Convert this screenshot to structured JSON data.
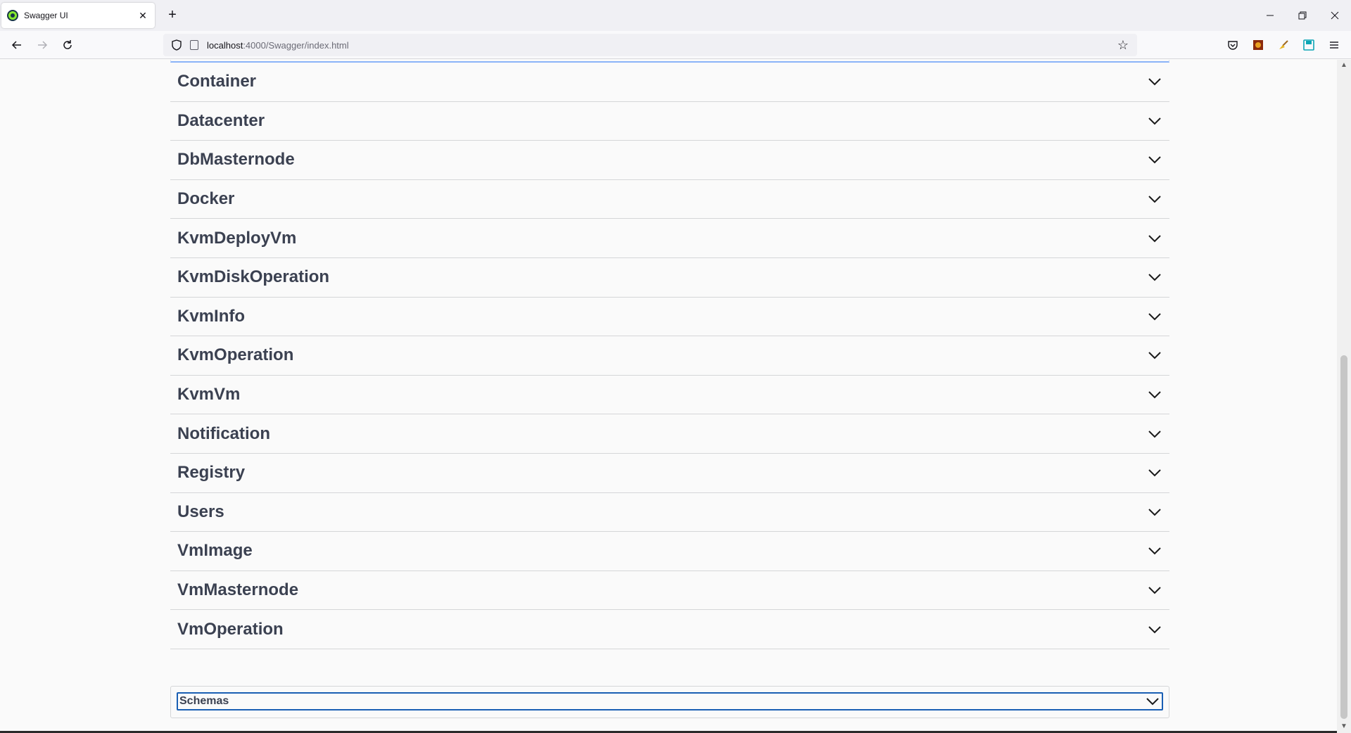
{
  "browser": {
    "tab_title": "Swagger UI",
    "new_tab_label": "+",
    "url_host": "localhost",
    "url_path": ":4000/Swagger/index.html"
  },
  "tags": [
    {
      "name": "Container"
    },
    {
      "name": "Datacenter"
    },
    {
      "name": "DbMasternode"
    },
    {
      "name": "Docker"
    },
    {
      "name": "KvmDeployVm"
    },
    {
      "name": "KvmDiskOperation"
    },
    {
      "name": "KvmInfo"
    },
    {
      "name": "KvmOperation"
    },
    {
      "name": "KvmVm"
    },
    {
      "name": "Notification"
    },
    {
      "name": "Registry"
    },
    {
      "name": "Users"
    },
    {
      "name": "VmImage"
    },
    {
      "name": "VmMasternode"
    },
    {
      "name": "VmOperation"
    }
  ],
  "schemas": {
    "label": "Schemas"
  },
  "icons": {
    "favicon": "swagger-icon",
    "chevron": "chevron-down-icon"
  },
  "colors": {
    "tag_text": "#3b4151",
    "focus_border": "#1a5fb4",
    "favicon": "#85ea2d"
  }
}
